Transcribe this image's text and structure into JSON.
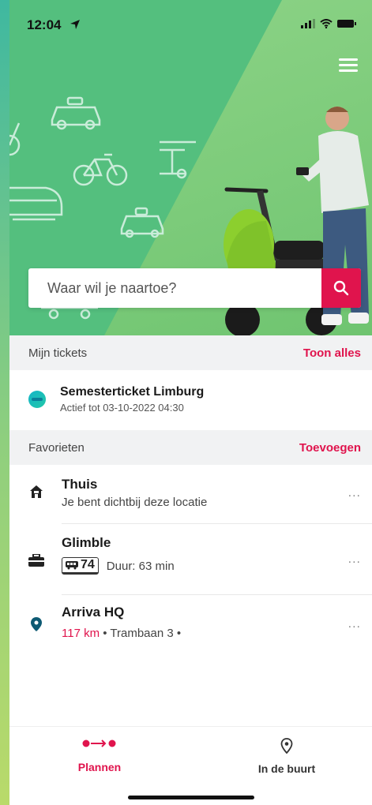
{
  "status_bar": {
    "time": "12:04"
  },
  "search": {
    "placeholder": "Waar wil je naartoe?"
  },
  "tickets": {
    "header": "Mijn tickets",
    "link": "Toon alles",
    "items": [
      {
        "name": "Semesterticket Limburg",
        "status": "Actief tot 03-10-2022 04:30"
      }
    ]
  },
  "favorites": {
    "header": "Favorieten",
    "link": "Toevoegen",
    "items": [
      {
        "title": "Thuis",
        "subtitle": "Je bent dichtbij deze locatie",
        "icon": "home-icon",
        "more": "..."
      },
      {
        "title": "Glimble",
        "line": "74",
        "duration": "Duur: 63 min",
        "icon": "briefcase-icon",
        "more": "..."
      },
      {
        "title": "Arriva HQ",
        "distance": "117 km",
        "address": "• Trambaan 3 •",
        "icon": "location-pin-icon",
        "more": "..."
      }
    ]
  },
  "tabs": [
    {
      "label": "Plannen",
      "icon": "route-icon",
      "active": true
    },
    {
      "label": "In de buurt",
      "icon": "nearby-pin-icon",
      "active": false
    }
  ],
  "colors": {
    "accent": "#e0144d",
    "hero_green": "#7ccb7a",
    "hero_teal": "#54bf7e"
  }
}
